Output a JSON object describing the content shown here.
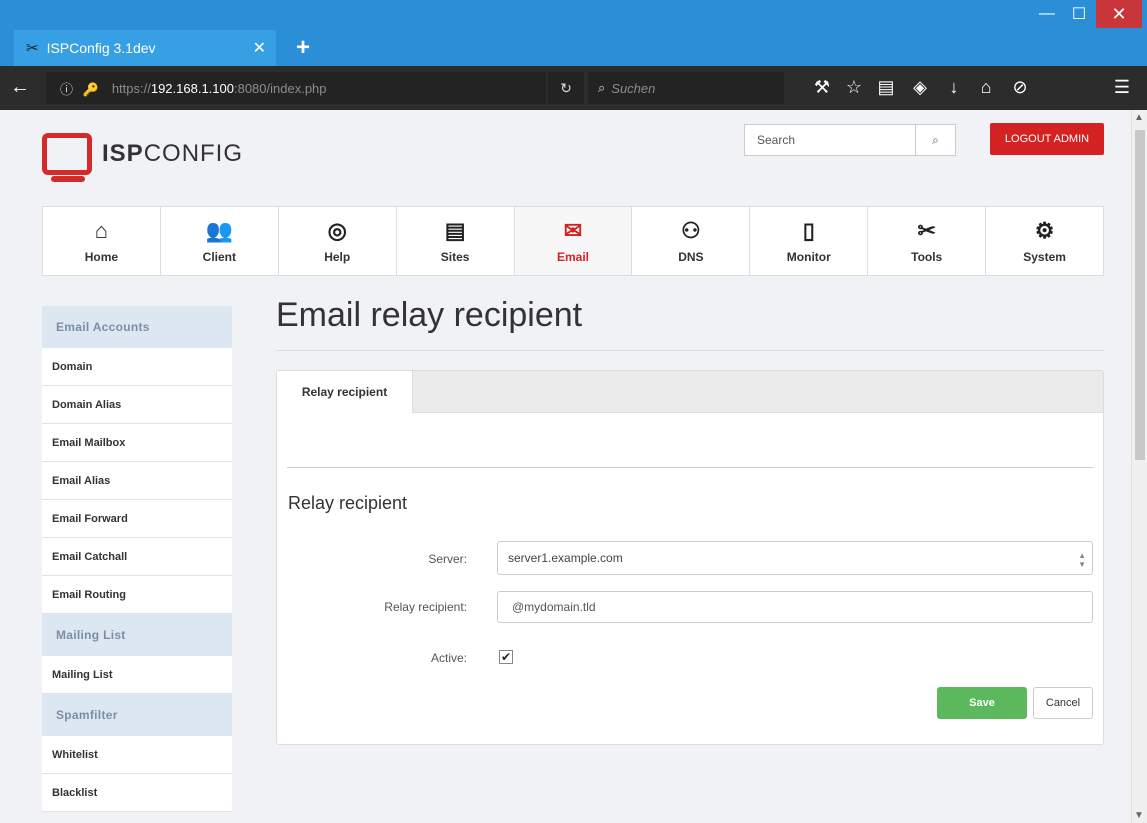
{
  "browser": {
    "tab_title": "ISPConfig 3.1dev",
    "tab_icon": "tools-icon",
    "close_tab": "✕",
    "new_tab": "+",
    "url_prefix": "https://",
    "url_host": "192.168.1.100",
    "url_rest": ":8080/index.php",
    "search_placeholder": "Suchen"
  },
  "header": {
    "logo_bold": "ISP",
    "logo_rest": "CONFIG",
    "search_placeholder": "Search",
    "logout_label": "LOGOUT ADMIN"
  },
  "mainnav": [
    {
      "label": "Home",
      "icon": "home-icon",
      "glyph": "⌂"
    },
    {
      "label": "Client",
      "icon": "users-icon",
      "glyph": "👥"
    },
    {
      "label": "Help",
      "icon": "lifebuoy-icon",
      "glyph": "◎"
    },
    {
      "label": "Sites",
      "icon": "sites-icon",
      "glyph": "▤"
    },
    {
      "label": "Email",
      "icon": "email-icon",
      "glyph": "✉",
      "active": true
    },
    {
      "label": "DNS",
      "icon": "dns-icon",
      "glyph": "⚇"
    },
    {
      "label": "Monitor",
      "icon": "monitor-icon",
      "glyph": "▯"
    },
    {
      "label": "Tools",
      "icon": "tools-icon",
      "glyph": "✂"
    },
    {
      "label": "System",
      "icon": "gear-icon",
      "glyph": "⚙"
    }
  ],
  "sidebar": {
    "sections": [
      {
        "heading": "Email Accounts",
        "items": [
          "Domain",
          "Domain Alias",
          "Email Mailbox",
          "Email Alias",
          "Email Forward",
          "Email Catchall",
          "Email Routing"
        ]
      },
      {
        "heading": "Mailing List",
        "items": [
          "Mailing List"
        ]
      },
      {
        "heading": "Spamfilter",
        "items": [
          "Whitelist",
          "Blacklist"
        ]
      }
    ]
  },
  "main": {
    "title": "Email relay recipient",
    "tab_label": "Relay recipient",
    "section_title": "Relay recipient",
    "server_label": "Server:",
    "server_value": "server1.example.com",
    "recipient_label": "Relay recipient:",
    "recipient_value": "@mydomain.tld",
    "active_label": "Active:",
    "active_checked": true,
    "save_label": "Save",
    "cancel_label": "Cancel"
  },
  "colors": {
    "accent": "#d42222",
    "save": "#5cb85c",
    "titlebar": "#2a8fd6"
  }
}
